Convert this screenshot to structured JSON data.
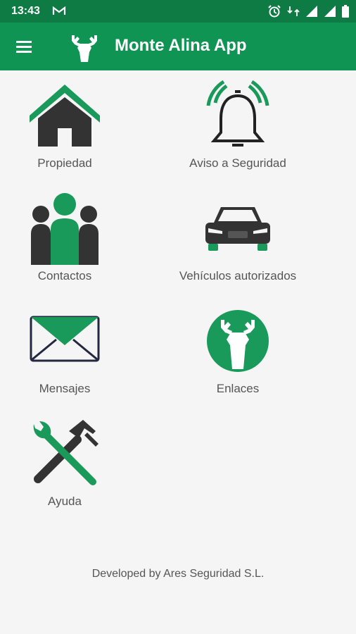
{
  "status_bar": {
    "time": "13:43",
    "icons": [
      "gmail-icon",
      "alarm-icon",
      "data-4g-icon",
      "signal-icon",
      "signal-icon",
      "battery-icon"
    ]
  },
  "app_bar": {
    "title": "Monte Alina App",
    "menu_icon": "hamburger-menu-icon",
    "logo_icon": "deer-logo-icon"
  },
  "menu": {
    "items": [
      {
        "label": "Propiedad",
        "icon": "house-icon"
      },
      {
        "label": "Aviso a Seguridad",
        "icon": "bell-icon"
      },
      {
        "label": "Contactos",
        "icon": "people-icon"
      },
      {
        "label": "Vehículos autorizados",
        "icon": "car-icon"
      },
      {
        "label": "Mensajes",
        "icon": "envelope-icon"
      },
      {
        "label": "Enlaces",
        "icon": "deer-icon"
      },
      {
        "label": "Ayuda",
        "icon": "tools-icon"
      }
    ]
  },
  "footer": {
    "text": "Developed by Ares Seguridad S.L."
  },
  "colors": {
    "primary": "#0f9453",
    "status_bar": "#0e7a44",
    "icon_dark": "#333333",
    "background": "#f5f5f5"
  }
}
